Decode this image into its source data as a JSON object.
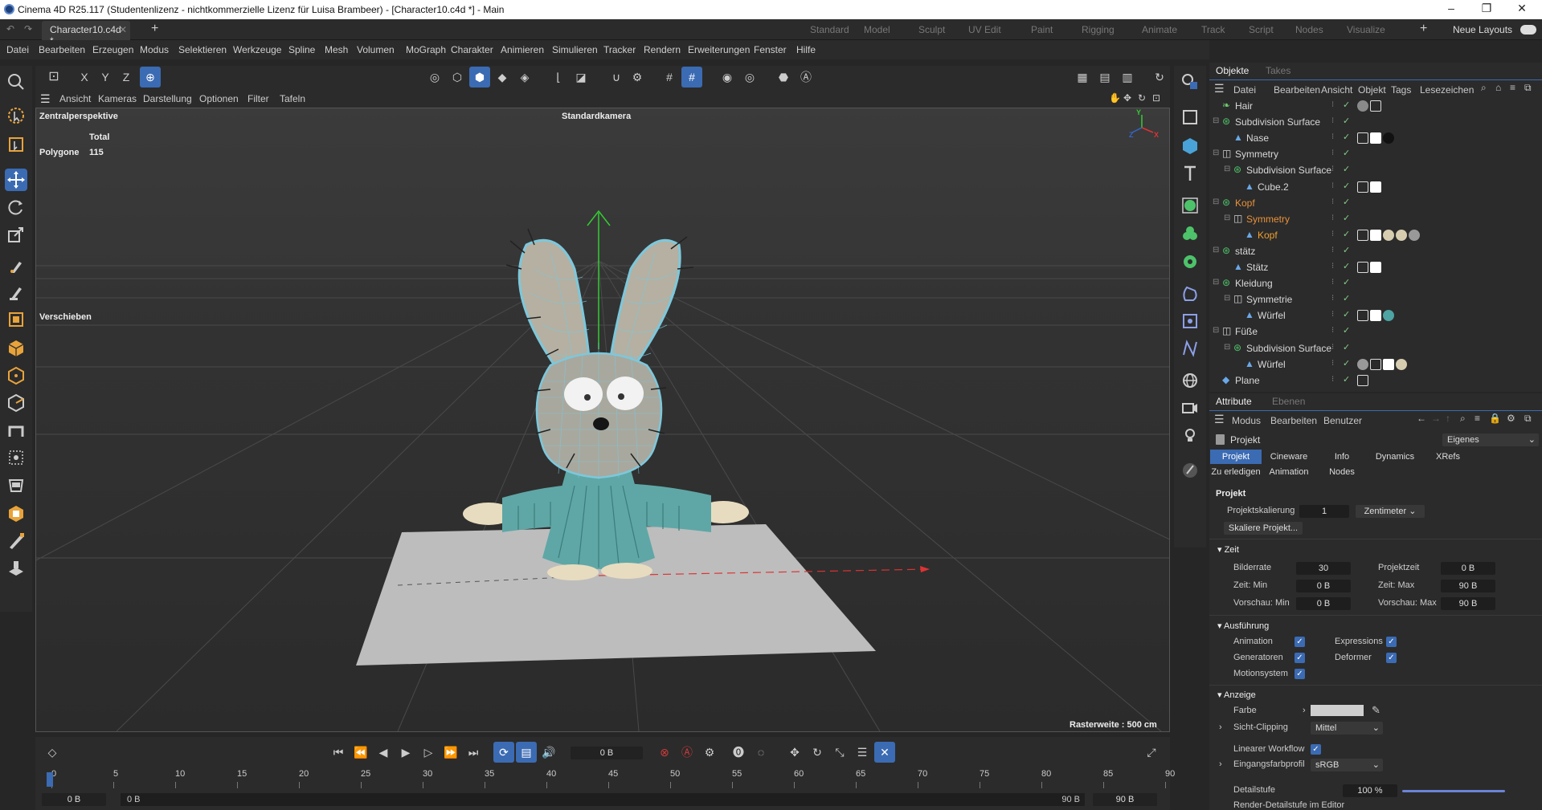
{
  "window": {
    "title": "Cinema 4D R25.117 (Studentenlizenz - nichtkommerzielle Lizenz für Luisa Brambeer) - [Character10.c4d *] - Main"
  },
  "doc_tab": {
    "label": "Character10.c4d *"
  },
  "layouts": [
    "Standard",
    "Model",
    "Sculpt",
    "UV Edit",
    "Paint",
    "Rigging",
    "Animate",
    "Track",
    "Script",
    "Nodes",
    "Visualize"
  ],
  "neue_layouts": "Neue Layouts",
  "menu": [
    "Datei",
    "Bearbeiten",
    "Erzeugen",
    "Modus",
    "Selektieren",
    "Werkzeuge",
    "Spline",
    "Mesh",
    "Volumen",
    "MoGraph",
    "Charakter",
    "Animieren",
    "Simulieren",
    "Tracker",
    "Rendern",
    "Erweiterungen",
    "Fenster",
    "Hilfe"
  ],
  "axis_buttons": [
    "X",
    "Y",
    "Z"
  ],
  "viewport_menu": [
    "Ansicht",
    "Kameras",
    "Darstellung",
    "Optionen",
    "Filter",
    "Tafeln"
  ],
  "viewport": {
    "perspective": "Zentralperspektive",
    "camera": "Standardkamera",
    "stats_total": "Total",
    "stats_label": "Polygone",
    "stats_value": "115",
    "tool_label": "Verschieben",
    "grid_label": "Rasterweite : 500 cm",
    "axis_x": "X",
    "axis_y": "Y",
    "axis_z": "Z"
  },
  "timeline": {
    "frame_field": "0 B",
    "ticks": [
      "0",
      "5",
      "10",
      "15",
      "20",
      "25",
      "30",
      "35",
      "40",
      "45",
      "50",
      "55",
      "60",
      "65",
      "70",
      "75",
      "80",
      "85",
      "90"
    ],
    "start": "0 B",
    "range_start": "0 B",
    "range_end": "90 B",
    "end": "90 B"
  },
  "objects_panel": {
    "tabs": [
      "Objekte",
      "Takes"
    ],
    "menu": [
      "Datei",
      "Bearbeiten",
      "Ansicht",
      "Objekt",
      "Tags",
      "Lesezeichen"
    ],
    "rows": [
      {
        "name": "Hair",
        "indent": 0,
        "color": "#d8d8d8",
        "icon": "hair",
        "tags": [
          "grey-material",
          "tex"
        ]
      },
      {
        "name": "Subdivision Surface",
        "indent": 0,
        "color": "#d8d8d8",
        "icon": "subdiv",
        "tags": []
      },
      {
        "name": "Nase",
        "indent": 1,
        "color": "#d8d8d8",
        "icon": "poly",
        "tags": [
          "tex",
          "check",
          "black-material"
        ]
      },
      {
        "name": "Symmetry",
        "indent": 0,
        "color": "#d8d8d8",
        "icon": "sym",
        "tags": []
      },
      {
        "name": "Subdivision Surface",
        "indent": 1,
        "color": "#d8d8d8",
        "icon": "subdiv",
        "tags": []
      },
      {
        "name": "Cube.2",
        "indent": 2,
        "color": "#d8d8d8",
        "icon": "poly",
        "tags": [
          "tex",
          "check"
        ]
      },
      {
        "name": "Kopf",
        "indent": 0,
        "color": "#e8913a",
        "icon": "subdiv",
        "tags": []
      },
      {
        "name": "Symmetry",
        "indent": 1,
        "color": "#e8913a",
        "icon": "sym",
        "tags": []
      },
      {
        "name": "Kopf",
        "indent": 2,
        "color": "#f0a030",
        "icon": "poly",
        "tags": [
          "tex",
          "check",
          "cream-material",
          "cream-material",
          "stripe-material"
        ]
      },
      {
        "name": "stätz",
        "indent": 0,
        "color": "#d8d8d8",
        "icon": "subdiv",
        "tags": []
      },
      {
        "name": "Stätz",
        "indent": 1,
        "color": "#d8d8d8",
        "icon": "poly",
        "tags": [
          "tex",
          "check"
        ]
      },
      {
        "name": "Kleidung",
        "indent": 0,
        "color": "#d8d8d8",
        "icon": "subdiv",
        "tags": []
      },
      {
        "name": "Symmetrie",
        "indent": 1,
        "color": "#d8d8d8",
        "icon": "sym",
        "tags": []
      },
      {
        "name": "Würfel",
        "indent": 2,
        "color": "#d8d8d8",
        "icon": "poly",
        "tags": [
          "tex",
          "check",
          "teal-material"
        ]
      },
      {
        "name": "Füße",
        "indent": 0,
        "color": "#d8d8d8",
        "icon": "sym",
        "tags": []
      },
      {
        "name": "Subdivision Surface",
        "indent": 1,
        "color": "#d8d8d8",
        "icon": "subdiv",
        "tags": []
      },
      {
        "name": "Würfel",
        "indent": 2,
        "color": "#d8d8d8",
        "icon": "poly",
        "tags": [
          "stripe-material",
          "tex",
          "check",
          "cream-material"
        ]
      },
      {
        "name": "Plane",
        "indent": 0,
        "color": "#d8d8d8",
        "icon": "plane",
        "tags": [
          "tex"
        ]
      }
    ]
  },
  "attributes_panel": {
    "tabs": [
      "Attribute",
      "Ebenen"
    ],
    "menu": [
      "Modus",
      "Bearbeiten",
      "Benutzer"
    ],
    "object_label": "Projekt",
    "dropdown": "Eigenes",
    "subtabs_row1": [
      "Projekt",
      "Cineware",
      "Info",
      "Dynamics",
      "XRefs"
    ],
    "subtabs_row2": [
      "Zu erledigen",
      "Animation",
      "Nodes"
    ],
    "section_title": "Projekt",
    "projektskalierung_label": "Projektskalierung",
    "projektskalierung_value": "1",
    "projektskalierung_unit": "Zentimeter",
    "skaliere_button": "Skaliere Projekt...",
    "zeit_section": "Zeit",
    "bilderrate_label": "Bilderrate",
    "bilderrate_value": "30",
    "projektzeit_label": "Projektzeit",
    "projektzeit_value": "0 B",
    "zeitmin_label": "Zeit: Min",
    "zeitmin_value": "0 B",
    "zeitmax_label": "Zeit: Max",
    "zeitmax_value": "90 B",
    "vorschaumin_label": "Vorschau: Min",
    "vorschaumin_value": "0 B",
    "vorschaumax_label": "Vorschau: Max",
    "vorschaumax_value": "90 B",
    "ausfuehrung_section": "Ausführung",
    "animation_label": "Animation",
    "expressions_label": "Expressions",
    "generatoren_label": "Generatoren",
    "deformer_label": "Deformer",
    "motionsystem_label": "Motionsystem",
    "anzeige_section": "Anzeige",
    "farbe_label": "Farbe",
    "farbe_color": "#cfcfcf",
    "sichtclipping_label": "Sicht-Clipping",
    "sichtclipping_value": "Mittel",
    "linearer_label": "Linearer Workflow",
    "eingangs_label": "Eingangsfarbprofil",
    "eingangs_value": "sRGB",
    "detail_label": "Detailstufe",
    "detail_value": "100 %",
    "renderdetail_label": "Render-Detailstufe im Editor"
  },
  "colors": {
    "accent": "#3b6bb3",
    "active_obj": "#e8913a",
    "record": "#d03a3a"
  }
}
